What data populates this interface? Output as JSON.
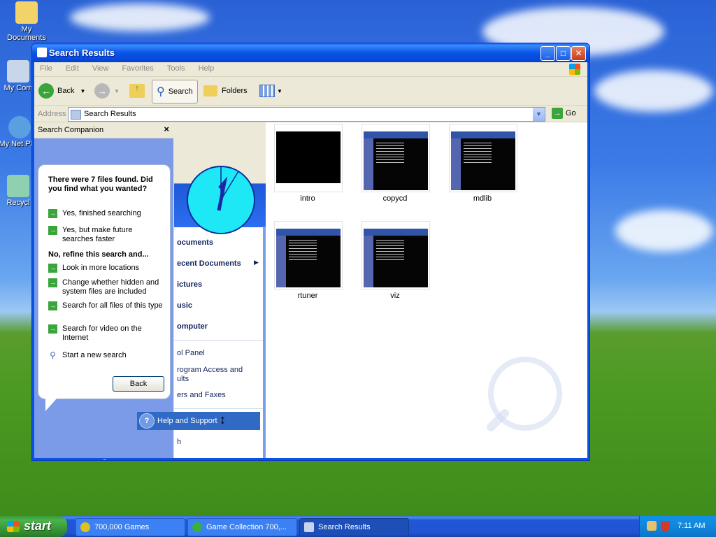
{
  "desktop": {
    "icons": [
      {
        "label": "My Documents"
      },
      {
        "label": "My Com"
      },
      {
        "label": "My Net Plac"
      },
      {
        "label": "Recycl"
      }
    ]
  },
  "window": {
    "title": "Search Results",
    "controls": {
      "minimize": "_",
      "maximize": "□",
      "close": "✕"
    }
  },
  "menubar": [
    "File",
    "Edit",
    "View",
    "Favorites",
    "Tools",
    "Help"
  ],
  "toolbar": {
    "back": "Back",
    "search": "Search",
    "folders": "Folders"
  },
  "address": {
    "label": "Address",
    "value": "Search Results",
    "go": "Go"
  },
  "companion": {
    "title": "Search Companion",
    "heading": "There were 7 files found. Did you find what you wanted?",
    "options_a": [
      "Yes, finished searching",
      "Yes, but make future searches faster"
    ],
    "refine_heading": "No, refine this search and...",
    "options_b": [
      "Look in more locations",
      "Change whether hidden and system files are included",
      "Search for all files of this type",
      "Search for video on the Internet"
    ],
    "new_search": "Start a new search",
    "back_button": "Back"
  },
  "startmenu": {
    "items": [
      "ocuments",
      "ecent Documents",
      "ictures",
      "usic",
      "omputer"
    ],
    "lower_items": [
      "ol Panel",
      "rogram Access and ults",
      "ers and Faxes"
    ],
    "help": "Help and Support",
    "last": "h"
  },
  "results": {
    "files": [
      "intro",
      "copycd",
      "mdlib",
      "rtuner",
      "viz"
    ]
  },
  "taskbar": {
    "start": "start",
    "tasks": [
      "700,000 Games",
      "Game Collection 700,...",
      "Search Results"
    ],
    "clock": "7:11 AM"
  }
}
